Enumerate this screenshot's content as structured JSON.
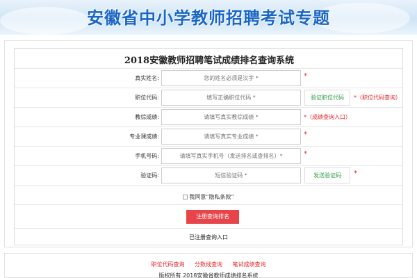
{
  "banner": {
    "title": "安徽省中小学教师招聘考试专题"
  },
  "form": {
    "title": "2018安徽教师招聘笔试成绩排名查询系统",
    "fields": [
      {
        "label": "真实姓名:",
        "placeholder": "您的姓名必须是汉字 *"
      },
      {
        "label": "职位代码:",
        "placeholder": "填写正确职位代码 *"
      },
      {
        "label": "教综成绩:",
        "placeholder": "请填写真实教综成绩 *"
      },
      {
        "label": "专业课成绩:",
        "placeholder": "请填写真实专业成绩 *"
      },
      {
        "label": "手机号码:",
        "placeholder": "请填写真实手机号（发送排名或查排名）*"
      },
      {
        "label": "验证码:",
        "placeholder": "短信验证码 *"
      }
    ],
    "required_mark": "*",
    "verify_position_button": "验证职位代码",
    "position_code_note": "*（职位代码查询）",
    "score_note": "*（成绩查询入口）",
    "send_code_button": "发送验证码",
    "agree_text": "我同意“隐私条款”",
    "register_button": "注册查询排名",
    "registered_link": "已注册查询入口"
  },
  "footer": {
    "links": [
      "职位代码查询",
      "分数线查询",
      "笔试成绩查询"
    ],
    "copyright": "版权所有 2018安徽省教师成绩排名系统"
  },
  "colors": {
    "accent_red": "#e8454a",
    "link_green": "#2a9a41",
    "title_blue": "#1a66c4"
  }
}
